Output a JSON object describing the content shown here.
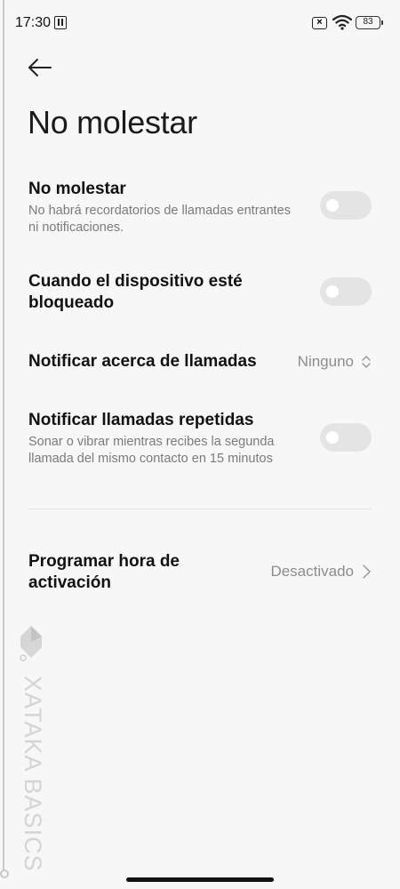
{
  "status_bar": {
    "time": "17:30",
    "battery_level": "83",
    "icons": [
      "nfc-icon",
      "no-sim-icon",
      "wifi-icon",
      "battery-icon"
    ]
  },
  "header": {
    "back_icon": "arrow-left-icon",
    "title": "No molestar"
  },
  "settings": [
    {
      "title": "No molestar",
      "subtitle": "No habrá recordatorios de llamadas entrantes ni notificaciones.",
      "control": "toggle",
      "enabled": false
    },
    {
      "title": "Cuando el dispositivo esté bloqueado",
      "control": "toggle",
      "enabled": false
    },
    {
      "title": "Notificar acerca de llamadas",
      "control": "selector",
      "value": "Ninguno",
      "icon": "sort-icon"
    },
    {
      "title": "Notificar llamadas repetidas",
      "subtitle": "Sonar o vibrar mientras recibes la segunda llamada del mismo contacto en 15 minutos",
      "control": "toggle",
      "enabled": false
    },
    {
      "title": "Programar hora de activación",
      "control": "link",
      "value": "Desactivado",
      "icon": "chevron-right-icon"
    }
  ],
  "watermark": {
    "text": "XATAKA BASICS"
  },
  "colors": {
    "background": "#f7f7f7",
    "toggle_off": "#e4e4e4",
    "secondary_text": "#7a7a7a"
  }
}
